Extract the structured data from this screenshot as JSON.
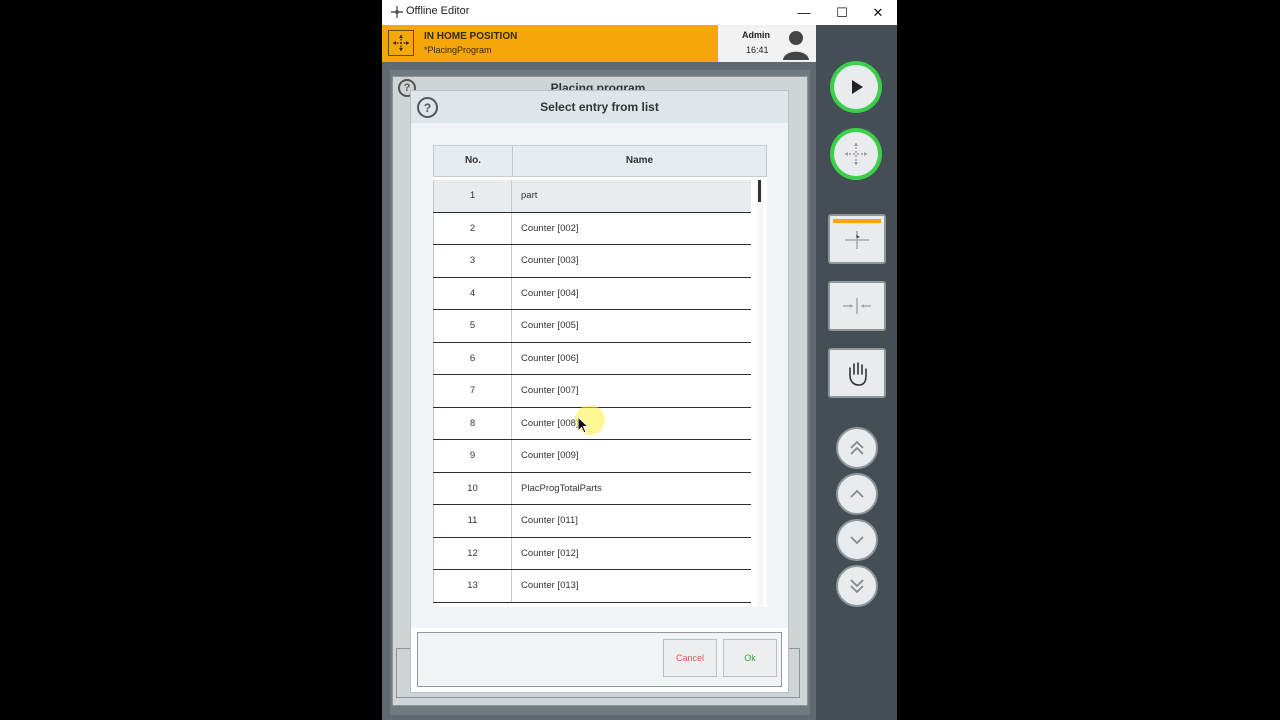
{
  "window": {
    "title": "Offline Editor",
    "minimize": "—",
    "maximize": "☐",
    "close": "✕"
  },
  "status": {
    "line1": "IN HOME POSITION",
    "line2": "*PlacingProgram"
  },
  "user": {
    "name": "Admin",
    "time": "16:41"
  },
  "background_panel": {
    "help": "?",
    "title": "Placing program"
  },
  "dialog": {
    "help": "?",
    "title": "Select entry from list",
    "columns": {
      "no": "No.",
      "name": "Name"
    },
    "rows": [
      {
        "no": "1",
        "name": "part"
      },
      {
        "no": "2",
        "name": "Counter [002]"
      },
      {
        "no": "3",
        "name": "Counter [003]"
      },
      {
        "no": "4",
        "name": "Counter [004]"
      },
      {
        "no": "5",
        "name": "Counter [005]"
      },
      {
        "no": "6",
        "name": "Counter [006]"
      },
      {
        "no": "7",
        "name": "Counter [007]"
      },
      {
        "no": "8",
        "name": "Counter [008]"
      },
      {
        "no": "9",
        "name": "Counter [009]"
      },
      {
        "no": "10",
        "name": "PlacProgTotalParts"
      },
      {
        "no": "11",
        "name": "Counter [011]"
      },
      {
        "no": "12",
        "name": "Counter [012]"
      },
      {
        "no": "13",
        "name": "Counter [013]"
      }
    ],
    "cancel_label": "Cancel",
    "ok_label": "Ok"
  },
  "colors": {
    "status_bar": "#f5a70a",
    "side_panel": "#434f55",
    "active_ring": "#3cd04a"
  }
}
